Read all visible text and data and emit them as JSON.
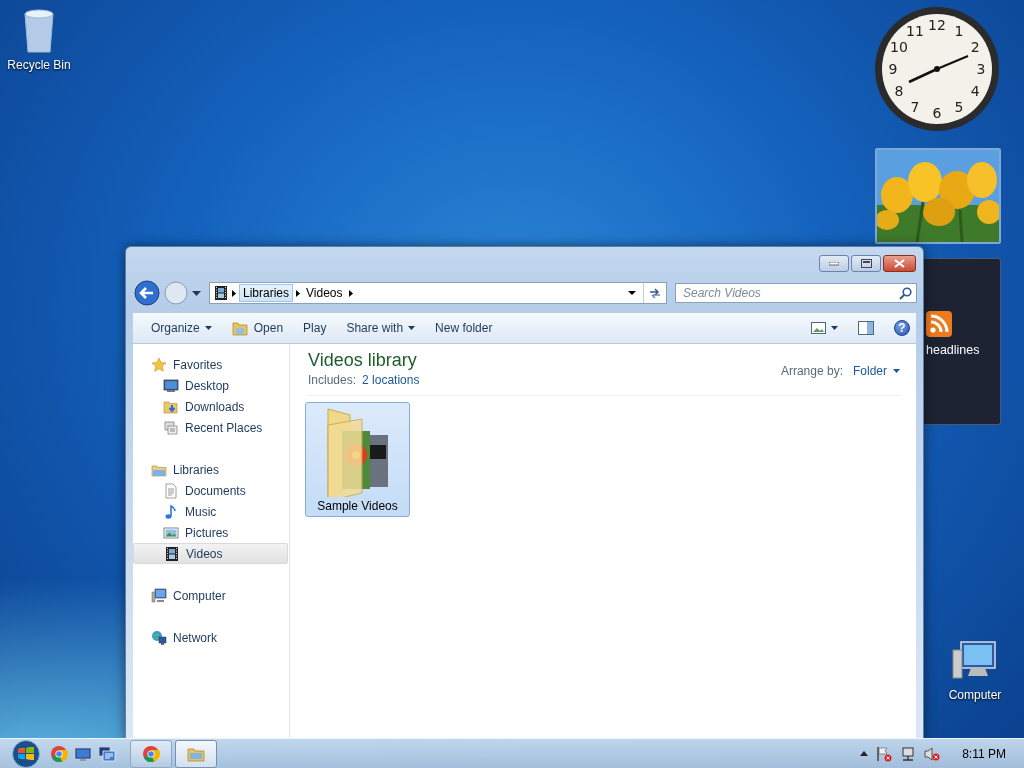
{
  "desktop_icons": [
    {
      "label": "Recycle Bin",
      "kind": "recycle"
    },
    {
      "label": "Computer",
      "kind": "computer"
    }
  ],
  "clock_gadget": {
    "numbers": [
      "12",
      "11",
      "1",
      "10",
      "2",
      "9",
      "3",
      "8",
      "4",
      "7",
      "5",
      "6"
    ]
  },
  "feed_gadget": {
    "label": "headlines"
  },
  "explorer": {
    "crumbs": [
      "Libraries",
      "Videos"
    ],
    "search": {
      "placeholder": "Search Videos"
    },
    "toolbar": [
      {
        "label": "Organize",
        "kind": "menu"
      },
      {
        "label": "Open",
        "kind": "icon"
      },
      {
        "label": "Play",
        "kind": "plain"
      },
      {
        "label": "Share with",
        "kind": "menu"
      },
      {
        "label": "New folder",
        "kind": "plain"
      }
    ],
    "help": "?",
    "sidebar": [
      {
        "label": "Favorites",
        "kind": "star",
        "selected": false,
        "children": [
          {
            "label": "Desktop",
            "kind": "desktop",
            "selected": false
          },
          {
            "label": "Downloads",
            "kind": "downloads",
            "selected": false
          },
          {
            "label": "Recent Places",
            "kind": "recent",
            "selected": false
          }
        ]
      },
      {
        "label": "Libraries",
        "kind": "library",
        "selected": false,
        "children": [
          {
            "label": "Documents",
            "kind": "document",
            "selected": false
          },
          {
            "label": "Music",
            "kind": "music",
            "selected": false
          },
          {
            "label": "Pictures",
            "kind": "pictures",
            "selected": false
          },
          {
            "label": "Videos",
            "kind": "film",
            "selected": true
          }
        ]
      },
      {
        "label": "Computer",
        "kind": "computer",
        "selected": false
      },
      {
        "label": "Network",
        "kind": "network",
        "selected": false
      }
    ],
    "title": "Videos library",
    "includes_label": "Includes:",
    "includes_link": "2 locations",
    "arrange_label": "Arrange by:",
    "arrange_value": "Folder",
    "items": [
      {
        "label": "Sample Videos",
        "selected": true
      }
    ]
  },
  "taskbar": {
    "quick_launch": [
      {
        "kind": "chrome"
      },
      {
        "kind": "desktop"
      },
      {
        "kind": "switch"
      }
    ],
    "tasks": [
      {
        "kind": "chrome",
        "active": false
      },
      {
        "kind": "explorer",
        "active": true
      }
    ],
    "time": "8:11 PM"
  }
}
